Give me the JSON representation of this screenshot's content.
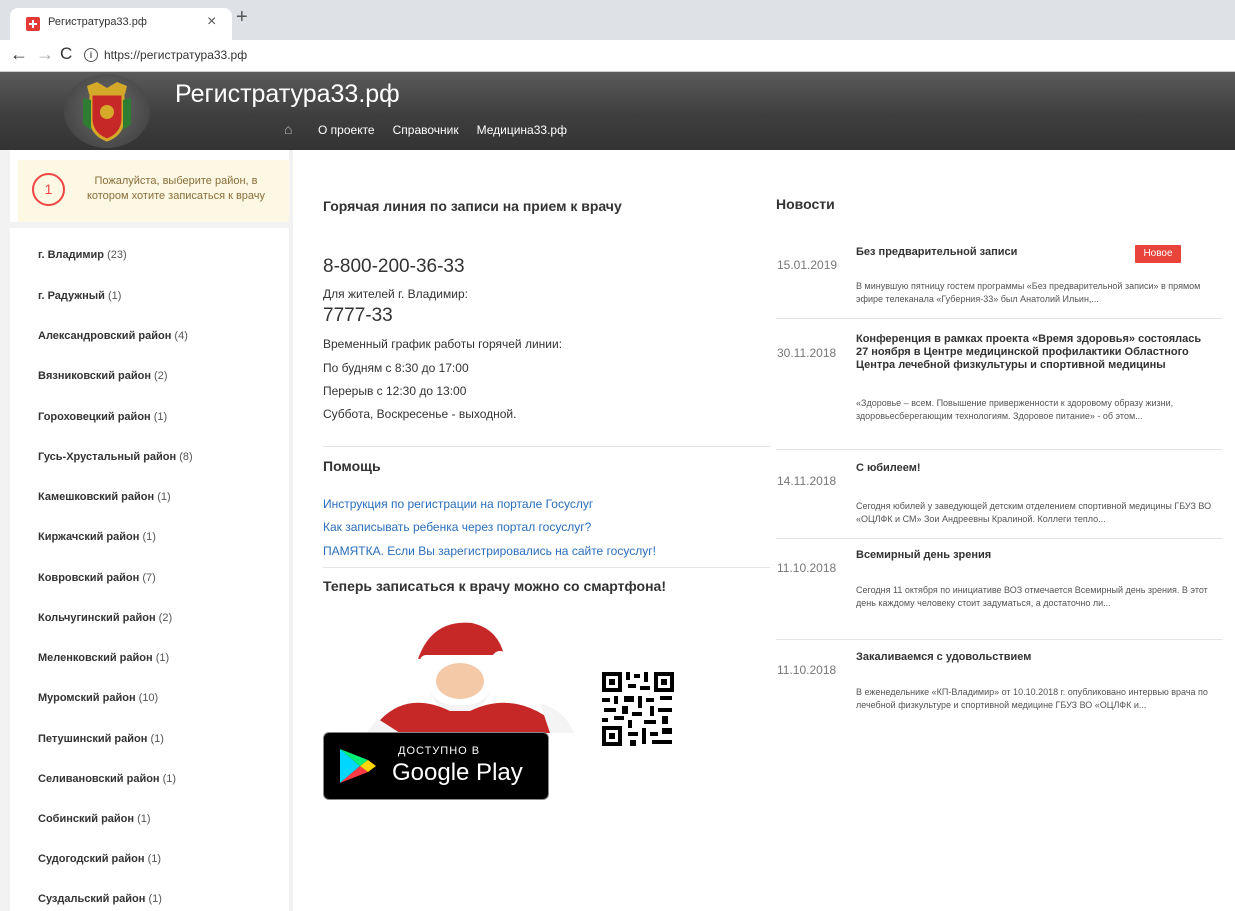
{
  "browser": {
    "tab_title": "Регистратура33.рф",
    "tab_close": "×",
    "new_tab": "+",
    "url": "https://регистратура33.рф"
  },
  "header": {
    "site_title": "Регистратура33.рф",
    "nav": [
      "О проекте",
      "Справочник",
      "Медицина33.рф"
    ]
  },
  "sidebar": {
    "step": "1",
    "prompt": "Пожалуйста, выберите район, в котором хотите записаться к врачу",
    "districts": [
      {
        "name": "г. Владимир",
        "count": "(23)"
      },
      {
        "name": "г. Радужный",
        "count": "(1)"
      },
      {
        "name": "Александровский район",
        "count": "(4)"
      },
      {
        "name": "Вязниковский район",
        "count": "(2)"
      },
      {
        "name": "Гороховецкий район",
        "count": "(1)"
      },
      {
        "name": "Гусь-Хрустальный район",
        "count": "(8)"
      },
      {
        "name": "Камешковский район",
        "count": "(1)"
      },
      {
        "name": "Киржачский район",
        "count": "(1)"
      },
      {
        "name": "Ковровский район",
        "count": "(7)"
      },
      {
        "name": "Кольчугинский район",
        "count": "(2)"
      },
      {
        "name": "Меленковский район",
        "count": "(1)"
      },
      {
        "name": "Муромский район",
        "count": "(10)"
      },
      {
        "name": "Петушинский район",
        "count": "(1)"
      },
      {
        "name": "Селивановский район",
        "count": "(1)"
      },
      {
        "name": "Собинский район",
        "count": "(1)"
      },
      {
        "name": "Судогодский район",
        "count": "(1)"
      },
      {
        "name": "Суздальский район",
        "count": "(1)"
      }
    ]
  },
  "hotline": {
    "heading": "Горячая линия по записи на прием к врачу",
    "phone_main": "8-800-200-36-33",
    "for_residents": "Для жителей г. Владимир:",
    "phone_city": "7777-33",
    "schedule": [
      "Временный график работы горячей линии:",
      "По будням с 8:30 до 17:00",
      "Перерыв с 12:30 до 13:00",
      "Суббота, Воскресенье - выходной."
    ]
  },
  "help": {
    "heading": "Помощь",
    "links": [
      "Инструкция по регистрации на портале Госуслуг",
      "Как записывать ребенка через портал госуслуг?",
      "ПАМЯТКА. Если Вы зарегистрировались на сайте госуслуг!"
    ]
  },
  "smartphone": {
    "heading": "Теперь записаться к врачу можно со смартфона!",
    "badge_small": "ДОСТУПНО В",
    "badge_big": "Google Play"
  },
  "news": {
    "heading": "Новости",
    "new_badge": "Новое",
    "items": [
      {
        "date": "15.01.2019",
        "title": "Без предварительной записи",
        "text": "В минувшую пятницу гостем программы «Без предварительной записи» в прямом эфире телеканала «Губерния-33» был  Анатолий Ильин,..."
      },
      {
        "date": "30.11.2018",
        "title": "Конференция в рамках проекта «Время здоровья» состоялась 27 ноября в Центре медицинской профилактики Областного Центра лечебной физкультуры и спортивной медицины",
        "text": "«Здоровье – всем. Повышение приверженности к здоровому образу жизни, здоровьесберегающим технологиям. Здоровое питание» - об этом..."
      },
      {
        "date": "14.11.2018",
        "title": "С юбилеем!",
        "text": "Сегодня юбилей у заведующей детским отделением спортивной медицины ГБУЗ ВО «ОЦЛФК и СМ» Зои Андреевны Кралиной. Коллеги тепло..."
      },
      {
        "date": "11.10.2018",
        "title": "Всемирный день зрения",
        "text": "Сегодня 11 октября по инициативе ВОЗ отмечается  Всемирный день зрения. В этот день каждому человеку стоит задуматься, а достаточно ли..."
      },
      {
        "date": "11.10.2018",
        "title": "Закаливаемся с удовольствием",
        "text": "В  еженедельнике «КП-Владимир» от 10.10.2018 г. опубликовано интервью врача по лечебной физкультуре и спортивной медицине ГБУЗ ВО «ОЦЛФК и..."
      }
    ]
  }
}
